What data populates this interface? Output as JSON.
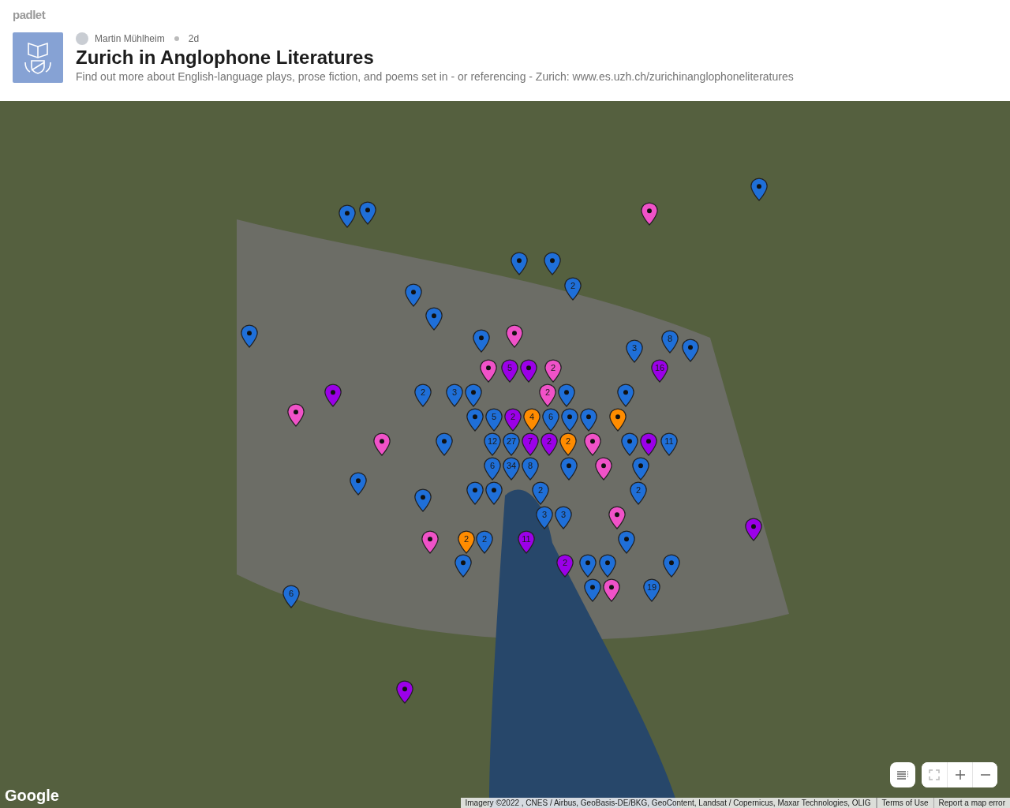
{
  "brand": "padlet",
  "header": {
    "author": "Martin Mühlheim",
    "age": "2d",
    "title": "Zurich in Anglophone Literatures",
    "description": "Find out more about English-language plays, prose fiction, and poems set in - or referencing - Zurich: www.es.uzh.ch/zurichinanglophoneliteratures"
  },
  "pins": [
    {
      "color": "#1f6fd8"
    },
    {
      "color": "#1f6fd8"
    },
    {
      "color": "#1f6fd8"
    },
    {
      "color": "#f052c8"
    },
    {
      "color": "#1f6fd8"
    },
    {
      "color": "#1f6fd8"
    },
    {
      "color": "#1f6fd8",
      "label": "2"
    },
    {
      "color": "#1f6fd8"
    },
    {
      "color": "#1f6fd8"
    },
    {
      "color": "#1f6fd8"
    },
    {
      "color": "#1f6fd8"
    },
    {
      "color": "#f052c8"
    },
    {
      "color": "#1f6fd8",
      "label": "3"
    },
    {
      "color": "#1f6fd8",
      "label": "8"
    },
    {
      "color": "#1f6fd8"
    },
    {
      "color": "#f052c8"
    },
    {
      "color": "#9b00e8",
      "label": "5"
    },
    {
      "color": "#9b00e8"
    },
    {
      "color": "#f052c8",
      "label": "2"
    },
    {
      "color": "#9b00e8",
      "label": "16"
    },
    {
      "color": "#9b00e8"
    },
    {
      "color": "#1f6fd8",
      "label": "2"
    },
    {
      "color": "#1f6fd8",
      "label": "3"
    },
    {
      "color": "#1f6fd8"
    },
    {
      "color": "#f052c8",
      "label": "2"
    },
    {
      "color": "#1f6fd8"
    },
    {
      "color": "#1f6fd8"
    },
    {
      "color": "#f052c8"
    },
    {
      "color": "#1f6fd8"
    },
    {
      "color": "#1f6fd8",
      "label": "5"
    },
    {
      "color": "#9b00e8",
      "label": "2"
    },
    {
      "color": "#ff8c00",
      "label": "4"
    },
    {
      "color": "#1f6fd8",
      "label": "6"
    },
    {
      "color": "#1f6fd8"
    },
    {
      "color": "#1f6fd8"
    },
    {
      "color": "#ff8c00"
    },
    {
      "color": "#f052c8"
    },
    {
      "color": "#1f6fd8"
    },
    {
      "color": "#1f6fd8",
      "label": "12"
    },
    {
      "color": "#1f6fd8",
      "label": "27"
    },
    {
      "color": "#9b00e8",
      "label": "7"
    },
    {
      "color": "#9b00e8",
      "label": "2"
    },
    {
      "color": "#ff8c00",
      "label": "2"
    },
    {
      "color": "#f052c8"
    },
    {
      "color": "#1f6fd8"
    },
    {
      "color": "#9b00e8"
    },
    {
      "color": "#1f6fd8",
      "label": "11"
    },
    {
      "color": "#1f6fd8"
    },
    {
      "color": "#1f6fd8",
      "label": "6"
    },
    {
      "color": "#1f6fd8",
      "label": "34"
    },
    {
      "color": "#1f6fd8",
      "label": "8"
    },
    {
      "color": "#1f6fd8"
    },
    {
      "color": "#f052c8"
    },
    {
      "color": "#1f6fd8"
    },
    {
      "color": "#1f6fd8"
    },
    {
      "color": "#1f6fd8"
    },
    {
      "color": "#1f6fd8"
    },
    {
      "color": "#1f6fd8",
      "label": "2"
    },
    {
      "color": "#1f6fd8",
      "label": "2"
    },
    {
      "color": "#1f6fd8",
      "label": "3"
    },
    {
      "color": "#1f6fd8",
      "label": "3"
    },
    {
      "color": "#f052c8"
    },
    {
      "color": "#9b00e8"
    },
    {
      "color": "#f052c8"
    },
    {
      "color": "#ff8c00",
      "label": "2"
    },
    {
      "color": "#1f6fd8",
      "label": "2"
    },
    {
      "color": "#9b00e8",
      "label": "11"
    },
    {
      "color": "#1f6fd8"
    },
    {
      "color": "#1f6fd8"
    },
    {
      "color": "#9b00e8",
      "label": "2"
    },
    {
      "color": "#1f6fd8"
    },
    {
      "color": "#1f6fd8"
    },
    {
      "color": "#1f6fd8"
    },
    {
      "color": "#1f6fd8",
      "label": "6"
    },
    {
      "color": "#1f6fd8"
    },
    {
      "color": "#f052c8"
    },
    {
      "color": "#1f6fd8",
      "label": "19"
    },
    {
      "color": "#9b00e8"
    }
  ],
  "map_logo": "Google",
  "attribution": {
    "imagery": "Imagery ©2022 , CNES / Airbus, GeoBasis-DE/BKG, GeoContent, Landsat / Copernicus, Maxar Technologies, OLIG",
    "terms": "Terms of Use",
    "report": "Report a map error"
  }
}
